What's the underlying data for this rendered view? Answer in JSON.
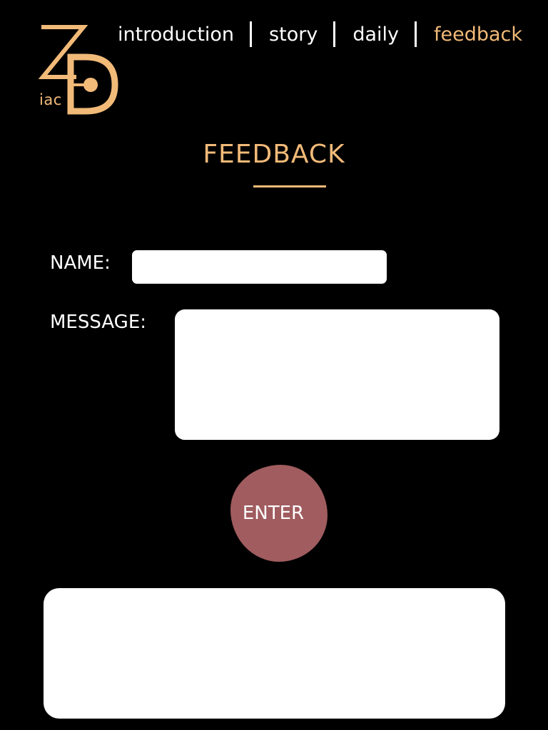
{
  "brand": {
    "logo_icon": "zodiac-zd-monogram",
    "logo_subtext": "iac",
    "accent_color": "#F2BA78"
  },
  "nav": {
    "items": [
      {
        "label": "introduction",
        "active": false
      },
      {
        "label": "story",
        "active": false
      },
      {
        "label": "daily",
        "active": false
      },
      {
        "label": "feedback",
        "active": true
      }
    ]
  },
  "page": {
    "title": "FEEDBACK"
  },
  "form": {
    "name_label": "NAME:",
    "name_value": "",
    "message_label": "MESSAGE:",
    "message_value": "",
    "submit_label": "ENTER",
    "submit_color": "#A05C5F"
  },
  "output": {
    "text": ""
  }
}
